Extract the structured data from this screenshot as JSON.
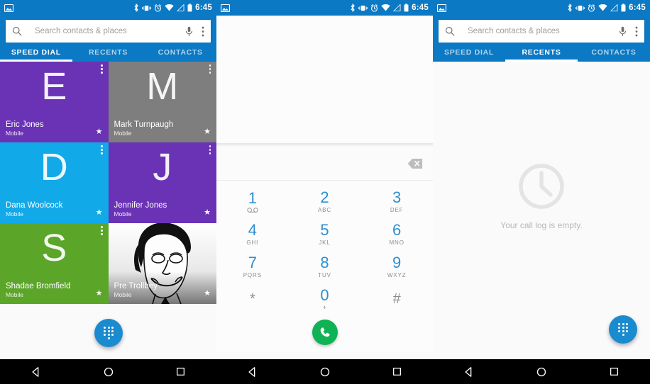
{
  "status_bar": {
    "notification_icon": "image-icon",
    "icons": [
      "bluetooth-icon",
      "vibrate-icon",
      "alarm-icon",
      "wifi-icon",
      "signal-icon",
      "battery-icon"
    ],
    "time": "6:45"
  },
  "search": {
    "placeholder": "Search contacts & places",
    "value": "",
    "search_icon": "search-icon",
    "mic_icon": "microphone-icon",
    "overflow_icon": "overflow-menu-icon"
  },
  "tabs": [
    {
      "label": "SPEED DIAL"
    },
    {
      "label": "RECENTS"
    },
    {
      "label": "CONTACTS"
    }
  ],
  "panel1": {
    "active_tab_index": 0,
    "speed_dial": [
      {
        "letter": "E",
        "name": "Eric Jones",
        "sub": "Mobile",
        "color": "#6a33b5",
        "type": "letter",
        "favorite": "★"
      },
      {
        "letter": "M",
        "name": "Mark Turnpaugh",
        "sub": "Mobile",
        "color": "#7e7e7e",
        "type": "letter",
        "favorite": "★"
      },
      {
        "letter": "D",
        "name": "Dana Woolcock",
        "sub": "Mobile",
        "color": "#12a9e8",
        "type": "letter",
        "favorite": "★"
      },
      {
        "letter": "J",
        "name": "Jennifer Jones",
        "sub": "Mobile",
        "color": "#6a33b5",
        "type": "letter",
        "favorite": "★"
      },
      {
        "letter": "S",
        "name": "Shadae Bromfield",
        "sub": "Mobile",
        "color": "#5ba529",
        "type": "letter",
        "favorite": "★"
      },
      {
        "letter": "",
        "name": "Pre Trollbey",
        "sub": "Mobile",
        "color": "#9a9a9a",
        "type": "photo",
        "favorite": "★"
      }
    ],
    "fab_icon": "dialpad-icon"
  },
  "panel2": {
    "digits_value": "",
    "backspace_icon": "backspace-icon",
    "keys": [
      {
        "num": "1",
        "sub": "",
        "voicemail": true
      },
      {
        "num": "2",
        "sub": "ABC"
      },
      {
        "num": "3",
        "sub": "DEF"
      },
      {
        "num": "4",
        "sub": "GHI"
      },
      {
        "num": "5",
        "sub": "JKL"
      },
      {
        "num": "6",
        "sub": "MNO"
      },
      {
        "num": "7",
        "sub": "PQRS"
      },
      {
        "num": "8",
        "sub": "TUV"
      },
      {
        "num": "9",
        "sub": "WXYZ"
      },
      {
        "num": "*",
        "sub": "",
        "symbol": true
      },
      {
        "num": "0",
        "sub": "+"
      },
      {
        "num": "#",
        "sub": "",
        "symbol": true
      }
    ],
    "call_icon": "phone-call-icon",
    "call_color": "#0fb255"
  },
  "panel3": {
    "active_tab_index": 1,
    "empty_icon": "clock-icon",
    "empty_message": "Your call log is empty.",
    "fab_icon": "dialpad-icon"
  },
  "nav_bar": {
    "back_icon": "back-triangle-icon",
    "home_icon": "home-circle-icon",
    "recents_icon": "recents-square-icon"
  },
  "colors": {
    "primary": "#0b79c4",
    "fab": "#1b8bd0",
    "dial_digit": "#2d8fd0",
    "call_green": "#0fb255"
  }
}
